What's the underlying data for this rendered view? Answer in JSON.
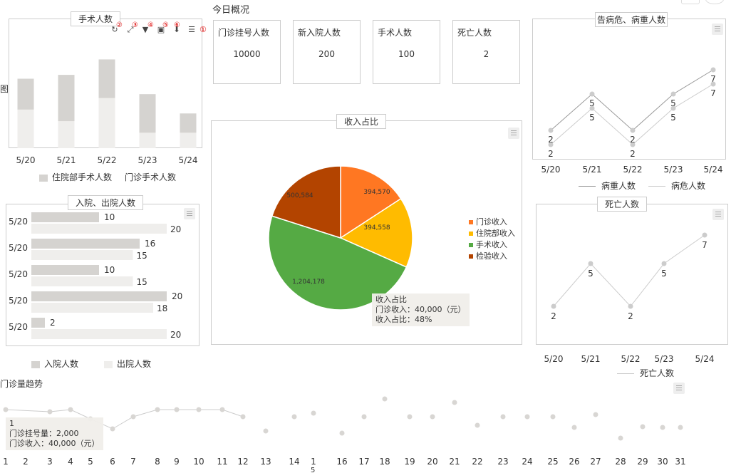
{
  "header": {
    "title": "今日概况"
  },
  "kpis": [
    {
      "label": "门诊挂号人数",
      "value": "10000"
    },
    {
      "label": "新入院人数",
      "value": "200"
    },
    {
      "label": "手术人数",
      "value": "100"
    },
    {
      "label": "死亡人数",
      "value": "2"
    }
  ],
  "surgery": {
    "title": "手术人数",
    "side_label": "图",
    "legend": [
      "住院部手术人数",
      "门诊手术人数"
    ],
    "toolbar_numbers": [
      "②",
      "③",
      "④",
      "⑤",
      "⑥",
      "①"
    ],
    "toolbar_icons": [
      "refresh-icon",
      "fullscreen-icon",
      "filter-icon",
      "save-icon",
      "download-icon",
      "list-icon"
    ],
    "chart_data": {
      "type": "bar",
      "stacked": true,
      "categories": [
        "5/20",
        "5/21",
        "5/22",
        "5/23",
        "5/24"
      ],
      "series": [
        {
          "name": "住院部手术人数",
          "values": [
            8,
            12,
            10,
            10,
            5
          ]
        },
        {
          "name": "门诊手术人数",
          "values": [
            10,
            7,
            13,
            4,
            4
          ]
        }
      ],
      "colors": [
        "#d5d3d0",
        "#efeeec"
      ],
      "ylim": [
        0,
        24
      ]
    }
  },
  "admission": {
    "title": "入院、出院人数",
    "legend": [
      "入院人数",
      "出院人数"
    ],
    "chart_data": {
      "type": "bar",
      "orientation": "horizontal",
      "categories": [
        "5/20",
        "5/20",
        "5/20",
        "5/20",
        "5/20"
      ],
      "series": [
        {
          "name": "入院人数",
          "values": [
            10,
            16,
            10,
            20,
            2
          ]
        },
        {
          "name": "出院人数",
          "values": [
            20,
            15,
            15,
            18,
            20
          ]
        }
      ],
      "colors": [
        "#d5d3d0",
        "#efeeec"
      ],
      "xlim": [
        0,
        21
      ]
    }
  },
  "income": {
    "title": "收入占比",
    "legend": [
      "门诊收入",
      "住院部收入",
      "手术收入",
      "检验收入"
    ],
    "tooltip": {
      "title": "收入占比",
      "line1": "门诊收入：40,000（元）",
      "line2": "收入占比：48%"
    },
    "chart_data": {
      "type": "pie",
      "labels": [
        "门诊收入",
        "住院部收入",
        "手术收入",
        "检验收入"
      ],
      "values": [
        394570,
        394558,
        1204178,
        500584
      ],
      "value_labels": [
        "394,570",
        "394,558",
        "1,204,178",
        "500,584"
      ],
      "colors": [
        "#ff7722",
        "#ffbb00",
        "#55aa44",
        "#b34400"
      ]
    }
  },
  "critical": {
    "title": "告病危、病重人数",
    "legend": [
      "病重人数",
      "病危人数"
    ],
    "chart_data": {
      "type": "line",
      "x": [
        "5/20",
        "5/21",
        "5/22",
        "5/23",
        "5/24"
      ],
      "series": [
        {
          "name": "病重人数",
          "values": [
            2,
            5,
            2,
            5,
            7
          ]
        },
        {
          "name": "病危人数",
          "values": [
            2,
            5,
            2,
            5,
            7
          ]
        }
      ],
      "colors": [
        "#999999",
        "#cccccc"
      ]
    }
  },
  "death": {
    "title": "死亡人数",
    "legend": [
      "死亡人数"
    ],
    "chart_data": {
      "type": "line",
      "x": [
        "5/20",
        "5/21",
        "5/22",
        "5/23",
        "5/24"
      ],
      "series": [
        {
          "name": "死亡人数",
          "values": [
            2,
            5,
            2,
            5,
            7
          ]
        }
      ],
      "colors": [
        "#cccccc"
      ]
    }
  },
  "trend": {
    "title": "门诊量趋势",
    "tooltip": {
      "title": "1",
      "line1": "门诊挂号量：2,000",
      "line2": "门诊收入：40,000（元）"
    },
    "overflow_label": "5",
    "chart_data": {
      "type": "line",
      "x": [
        "1",
        "2",
        "3",
        "4",
        "5",
        "6",
        "7",
        "8",
        "9",
        "10",
        "11",
        "12",
        "13",
        "14",
        "1",
        "16",
        "17",
        "18",
        "19",
        "20",
        "21",
        "22",
        "23",
        "24",
        "25",
        "26",
        "27",
        "28",
        "29",
        "30",
        "31"
      ],
      "series": [
        {
          "name": "门诊挂号量",
          "values": [
            55,
            null,
            52,
            55,
            42,
            28,
            45,
            55,
            55,
            55,
            55,
            45,
            null,
            null,
            null,
            null,
            null,
            null,
            null,
            null,
            null,
            null,
            null,
            null,
            null,
            null,
            null,
            null,
            null,
            null,
            null
          ]
        },
        {
          "name": "门诊收入",
          "values": [
            null,
            null,
            null,
            null,
            null,
            null,
            null,
            null,
            null,
            null,
            null,
            null,
            25,
            45,
            50,
            22,
            45,
            70,
            45,
            45,
            65,
            33,
            45,
            45,
            45,
            30,
            48,
            15,
            31,
            30,
            30
          ]
        }
      ],
      "colors": [
        "#cccccc",
        "#cccccc"
      ],
      "ylim": [
        0,
        100
      ]
    }
  }
}
